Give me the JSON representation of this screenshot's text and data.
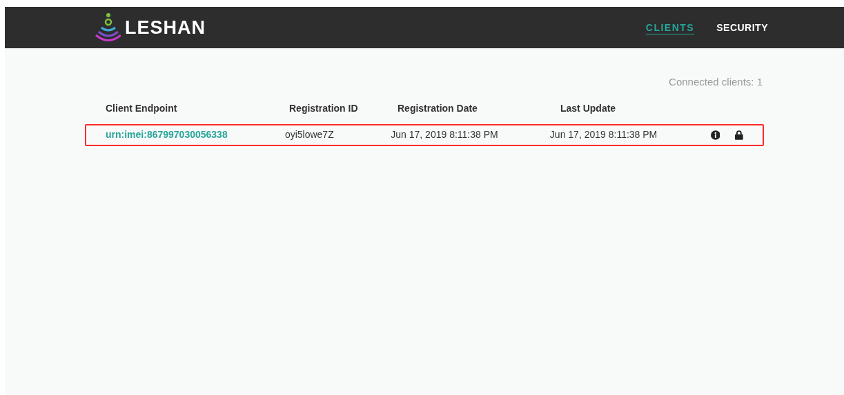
{
  "header": {
    "logo_text": "LESHAN",
    "nav": [
      {
        "label": "CLIENTS",
        "selected": true
      },
      {
        "label": "SECURITY",
        "selected": false
      }
    ]
  },
  "connected_clients": "Connected clients: 1",
  "table": {
    "columns": [
      "Client Endpoint",
      "Registration ID",
      "Registration Date",
      "Last Update"
    ],
    "rows": [
      {
        "endpoint": "urn:imei:867997030056338",
        "registration_id": "oyi5lowe7Z",
        "registration_date": "Jun 17, 2019 8:11:38 PM",
        "last_update": "Jun 17, 2019 8:11:38 PM",
        "highlighted": true,
        "secure": true
      }
    ]
  }
}
